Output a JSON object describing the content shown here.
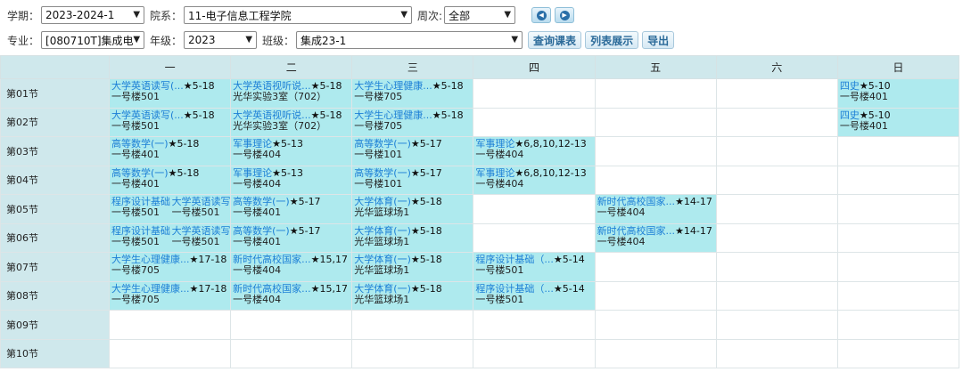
{
  "filters": {
    "term_label": "学期：",
    "term_value": "2023-2024-1",
    "dept_label": "院系：",
    "dept_value": "11-电子信息工程学院",
    "week_label": "周次:",
    "week_value": "全部",
    "major_label": "专业：",
    "major_value": "[080710T]集成电",
    "grade_label": "年级：",
    "grade_value": "2023",
    "class_label": "班级：",
    "class_value": "集成23-1",
    "query_btn": "查询课表",
    "list_btn": "列表展示",
    "export_btn": "导出"
  },
  "timetable": {
    "days": [
      "一",
      "二",
      "三",
      "四",
      "五",
      "六",
      "日"
    ],
    "periods": [
      "第01节",
      "第02节",
      "第03节",
      "第04节",
      "第05节",
      "第06节",
      "第07节",
      "第08节",
      "第09节",
      "第10节"
    ],
    "cells": {
      "p1": {
        "d1": {
          "course": "大学英语读写(...",
          "weeks": "★5-18",
          "room": "一号楼501"
        },
        "d2": {
          "course": "大学英语视听说...",
          "weeks": "★5-18",
          "room": "光华实验3室（702）"
        },
        "d3": {
          "course": "大学生心理健康...",
          "weeks": "★5-18",
          "room": "一号楼705"
        },
        "d7": {
          "course": "四史",
          "weeks": "★5-10",
          "room": "一号楼401"
        }
      },
      "p2": {
        "d1": {
          "course": "大学英语读写(...",
          "weeks": "★5-18",
          "room": "一号楼501"
        },
        "d2": {
          "course": "大学英语视听说...",
          "weeks": "★5-18",
          "room": "光华实验3室（702）"
        },
        "d3": {
          "course": "大学生心理健康...",
          "weeks": "★5-18",
          "room": "一号楼705"
        },
        "d7": {
          "course": "四史",
          "weeks": "★5-10",
          "room": "一号楼401"
        }
      },
      "p3": {
        "d1": {
          "course": "高等数学(一)",
          "weeks": "★5-18",
          "room": "一号楼401"
        },
        "d2": {
          "course": "军事理论",
          "weeks": "★5-13",
          "room": "一号楼404"
        },
        "d3": {
          "course": "高等数学(一)",
          "weeks": "★5-17",
          "room": "一号楼101"
        },
        "d4": {
          "course": "军事理论",
          "weeks": "★6,8,10,12-13",
          "room": "一号楼404"
        }
      },
      "p4": {
        "d1": {
          "course": "高等数学(一)",
          "weeks": "★5-18",
          "room": "一号楼401"
        },
        "d2": {
          "course": "军事理论",
          "weeks": "★5-13",
          "room": "一号楼404"
        },
        "d3": {
          "course": "高等数学(一)",
          "weeks": "★5-17",
          "room": "一号楼101"
        },
        "d4": {
          "course": "军事理论",
          "weeks": "★6,8,10,12-13",
          "room": "一号楼404"
        }
      },
      "p5": {
        "d1a": {
          "course": "程序设计基础",
          "room": "一号楼501"
        },
        "d1b": {
          "course": "大学英语读写",
          "room": "一号楼501"
        },
        "d2": {
          "course": "高等数学(一)",
          "weeks": "★5-17",
          "room": "一号楼401"
        },
        "d3": {
          "course": "大学体育(一)",
          "weeks": "★5-18",
          "room": "光华篮球场1"
        },
        "d5": {
          "course": "新时代高校国家...",
          "weeks": "★14-17",
          "room": "一号楼404"
        }
      },
      "p6": {
        "d1a": {
          "course": "程序设计基础",
          "room": "一号楼501"
        },
        "d1b": {
          "course": "大学英语读写",
          "room": "一号楼501"
        },
        "d2": {
          "course": "高等数学(一)",
          "weeks": "★5-17",
          "room": "一号楼401"
        },
        "d3": {
          "course": "大学体育(一)",
          "weeks": "★5-18",
          "room": "光华篮球场1"
        },
        "d5": {
          "course": "新时代高校国家...",
          "weeks": "★14-17",
          "room": "一号楼404"
        }
      },
      "p7": {
        "d1": {
          "course": "大学生心理健康...",
          "weeks": "★17-18",
          "room": "一号楼705"
        },
        "d2": {
          "course": "新时代高校国家...",
          "weeks": "★15,17",
          "room": "一号楼404"
        },
        "d3": {
          "course": "大学体育(一)",
          "weeks": "★5-18",
          "room": "光华篮球场1"
        },
        "d4": {
          "course": "程序设计基础（...",
          "weeks": "★5-14",
          "room": "一号楼501"
        }
      },
      "p8": {
        "d1": {
          "course": "大学生心理健康...",
          "weeks": "★17-18",
          "room": "一号楼705"
        },
        "d2": {
          "course": "新时代高校国家...",
          "weeks": "★15,17",
          "room": "一号楼404"
        },
        "d3": {
          "course": "大学体育(一)",
          "weeks": "★5-18",
          "room": "光华篮球场1"
        },
        "d4": {
          "course": "程序设计基础（...",
          "weeks": "★5-14",
          "room": "一号楼501"
        }
      }
    }
  }
}
